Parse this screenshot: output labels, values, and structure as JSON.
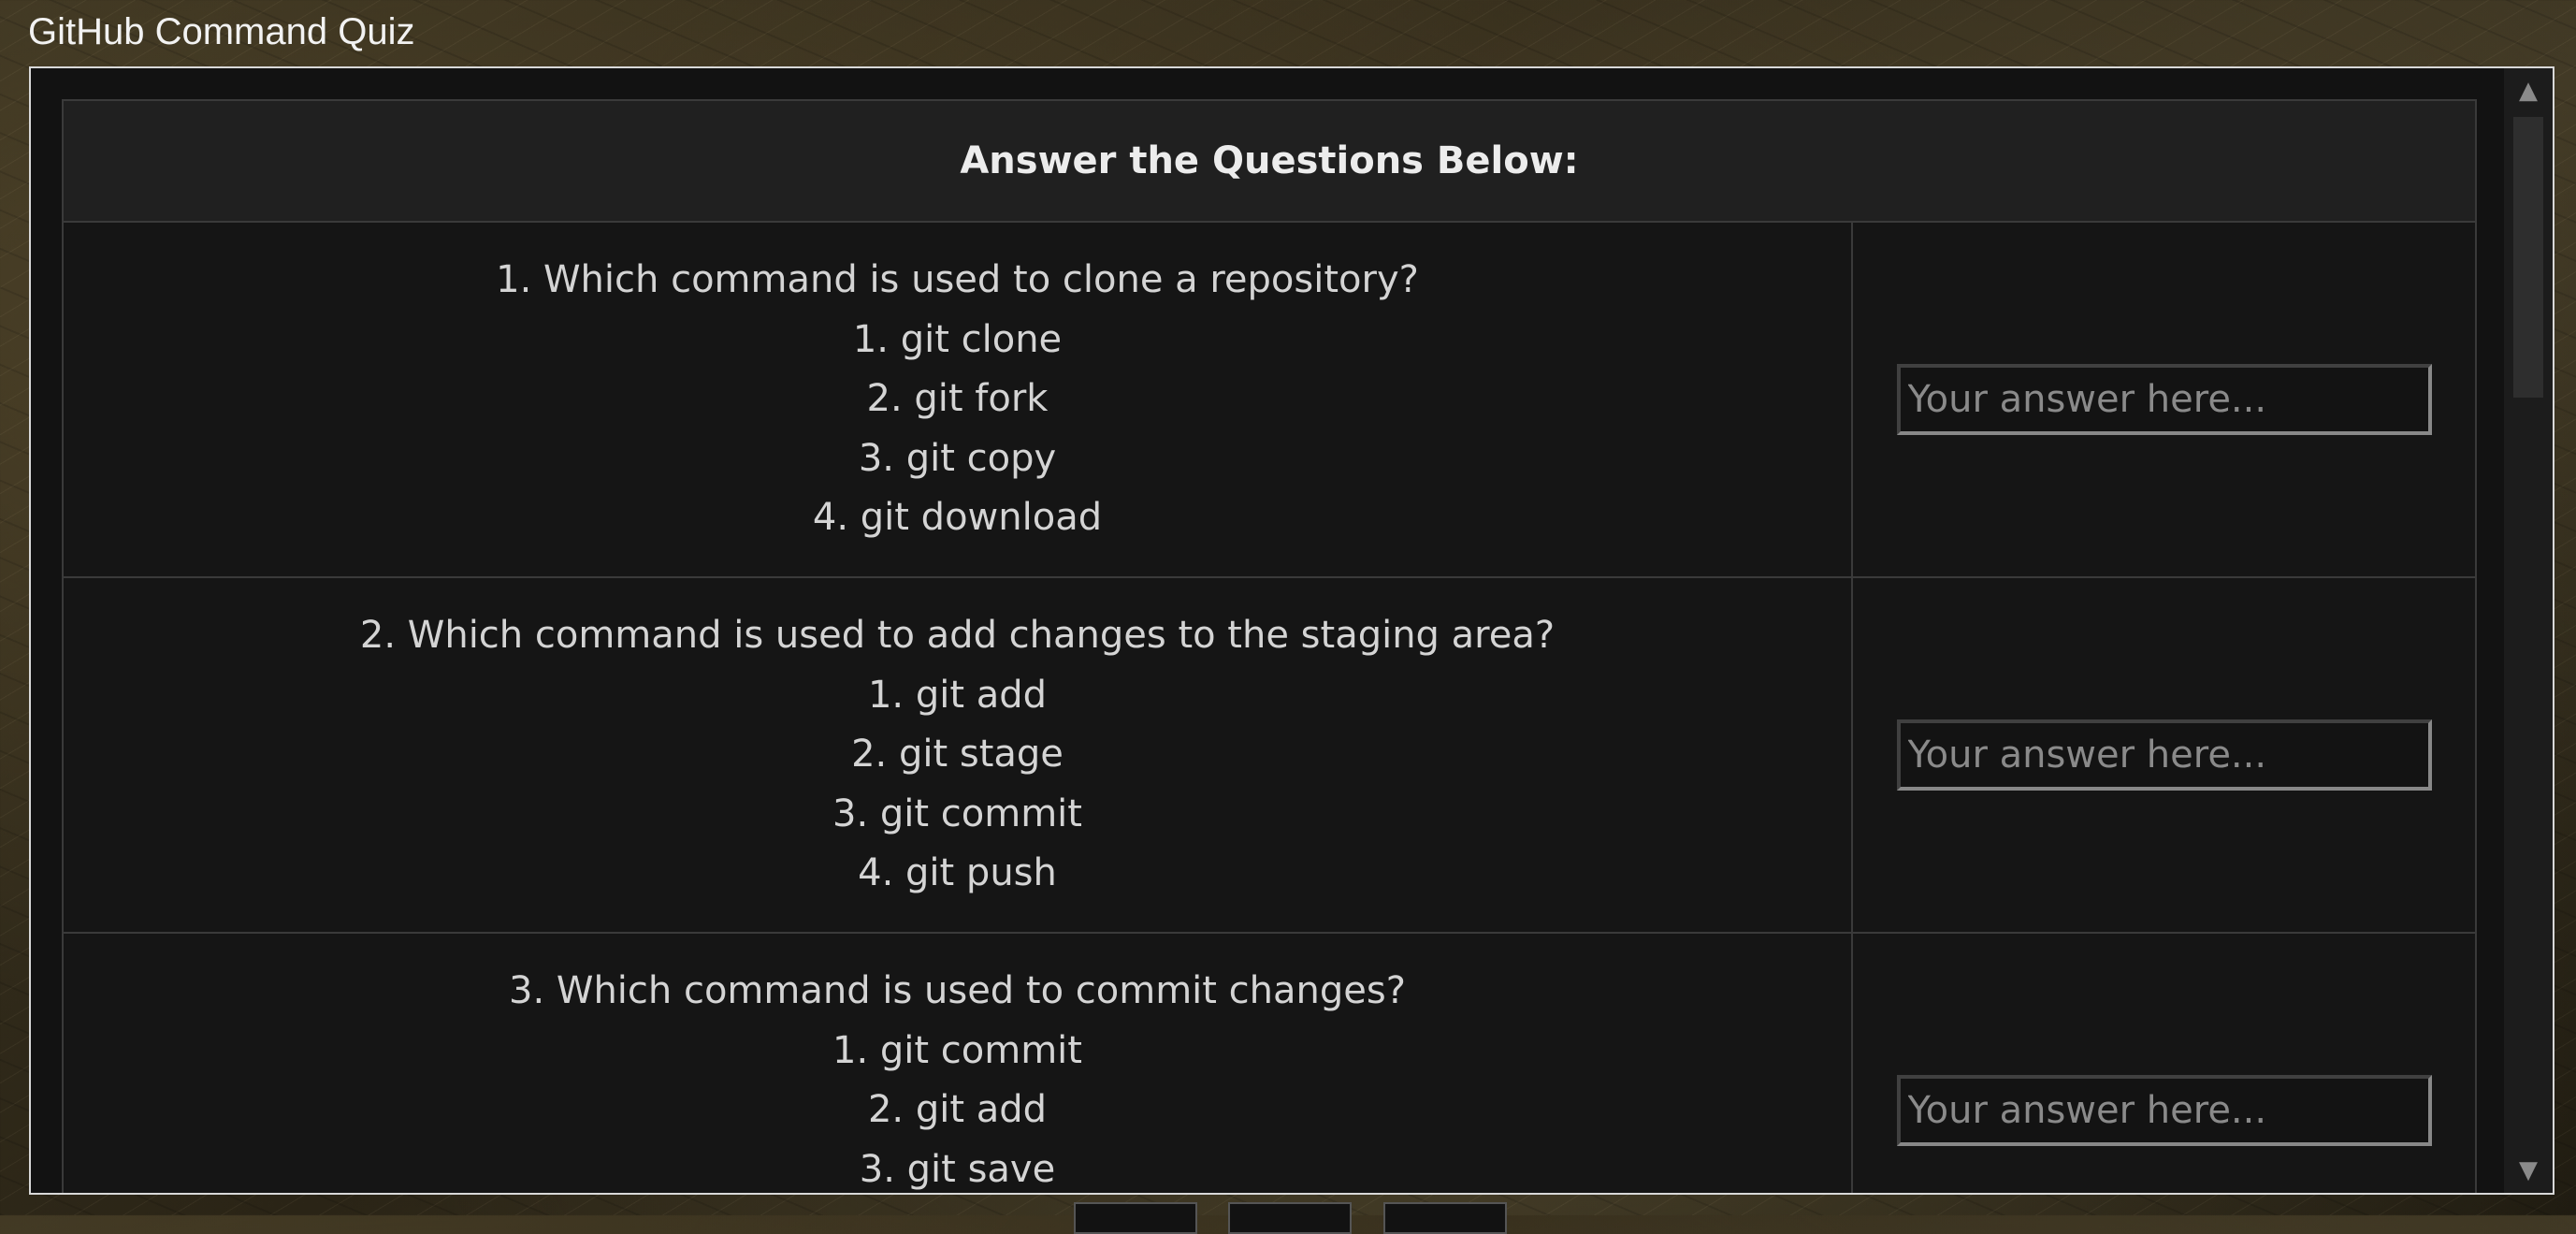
{
  "window": {
    "title": "GitHub Command Quiz"
  },
  "quiz": {
    "header": "Answer the Questions Below:",
    "questions": [
      {
        "question": "1. Which command is used to clone a repository?",
        "options": [
          "1. git clone",
          "2. git fork",
          "3. git copy",
          "4. git download"
        ],
        "answer_placeholder": "Your answer here..."
      },
      {
        "question": "2. Which command is used to add changes to the staging area?",
        "options": [
          "1. git add",
          "2. git stage",
          "3. git commit",
          "4. git push"
        ],
        "answer_placeholder": "Your answer here..."
      },
      {
        "question": "3. Which command is used to commit changes?",
        "options": [
          "1. git commit",
          "2. git add",
          "3. git save"
        ],
        "answer_placeholder": "Your answer here..."
      }
    ]
  },
  "scrollbar": {
    "up_icon": "scroll-up-arrow-icon",
    "down_icon": "scroll-down-arrow-icon"
  }
}
